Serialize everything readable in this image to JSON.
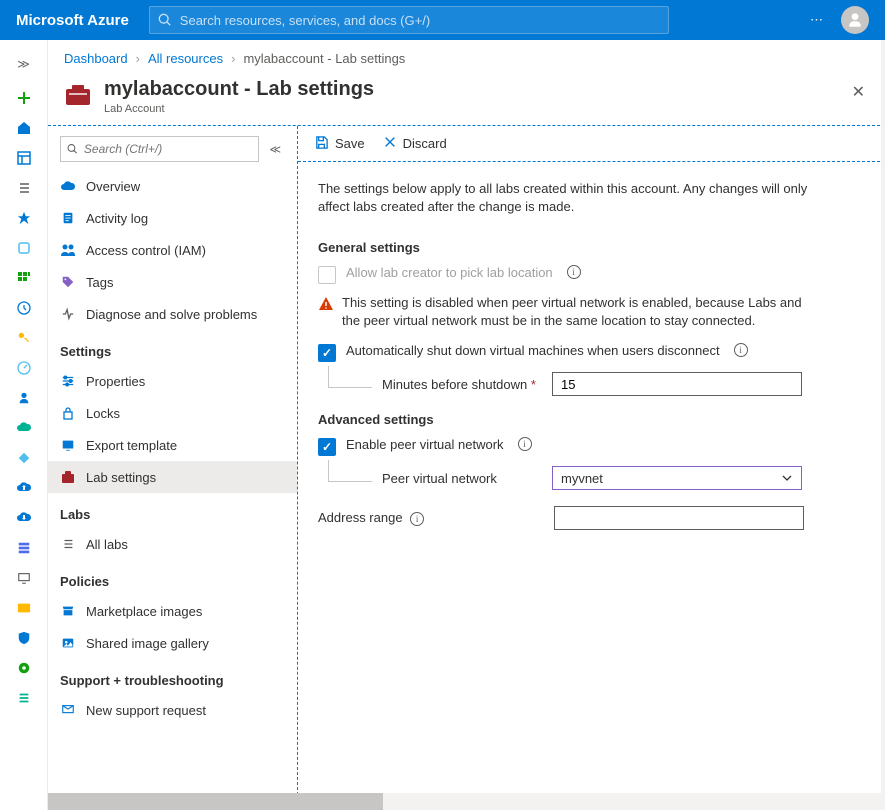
{
  "brand": "Microsoft Azure",
  "search": {
    "placeholder": "Search resources, services, and docs (G+/)"
  },
  "breadcrumb": {
    "dashboard": "Dashboard",
    "all_resources": "All resources",
    "current": "mylabaccount - Lab settings"
  },
  "page": {
    "title": "mylabaccount - Lab settings",
    "subtitle": "Lab Account"
  },
  "blade_search": {
    "placeholder": "Search (Ctrl+/)"
  },
  "nav": {
    "overview": "Overview",
    "activity_log": "Activity log",
    "access_control": "Access control (IAM)",
    "tags": "Tags",
    "diagnose": "Diagnose and solve problems",
    "section_settings": "Settings",
    "properties": "Properties",
    "locks": "Locks",
    "export_template": "Export template",
    "lab_settings": "Lab settings",
    "section_labs": "Labs",
    "all_labs": "All labs",
    "section_policies": "Policies",
    "marketplace_images": "Marketplace images",
    "shared_gallery": "Shared image gallery",
    "section_support": "Support + troubleshooting",
    "new_support": "New support request"
  },
  "cmd": {
    "save": "Save",
    "discard": "Discard"
  },
  "settings": {
    "description": "The settings below apply to all labs created within this account. Any changes will only affect labs created after the change is made.",
    "general_heading": "General settings",
    "allow_location": "Allow lab creator to pick lab location",
    "location_warning": "This setting is disabled when peer virtual network is enabled, because Labs and the peer virtual network must be in the same location to stay connected.",
    "auto_shutdown": "Automatically shut down virtual machines when users disconnect",
    "minutes_label": "Minutes before shutdown",
    "minutes_value": "15",
    "advanced_heading": "Advanced settings",
    "enable_peer": "Enable peer virtual network",
    "peer_label": "Peer virtual network",
    "peer_value": "myvnet",
    "address_range": "Address range"
  }
}
